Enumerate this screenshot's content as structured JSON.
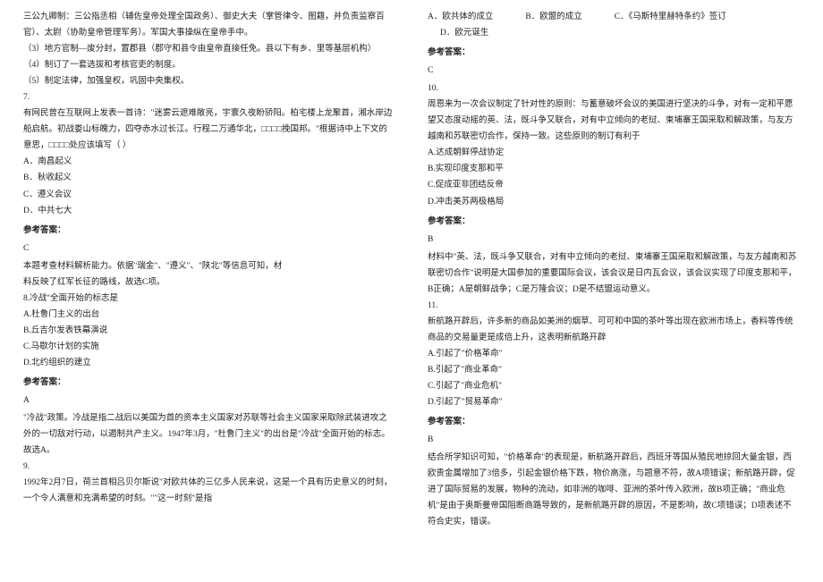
{
  "left": {
    "intro1": "三公九卿制：三公指丞相（辅佐皇帝处理全国政务）、御史大夫（掌管律令、图籍，并负责监察百官）、太尉（协助皇帝管理军务）。军国大事操纵在皇帝手中。",
    "intro2": "（3）地方官制—废分封，置郡县（郡守和县令由皇帝直接任免。县以下有乡、里等基层机构）",
    "intro3": "（4）制订了一套选拔和考核官吏的制度。",
    "intro4": "（5）制定法律，加强皇权，巩固中央集权。",
    "q7num": "7.",
    "q7stem": "有网民曾在互联网上发表一首诗：\"迷雾云遮难敞亮，宇寰久夜盼骄阳。柏宅楼上龙聚首，湘水岸边船启航。初战娄山标魄力，四夺赤水过长江。行程二万通华北，□□□□挽国邦。\"根据诗中上下文的意思，□□□□处应该填写（    ）",
    "q7optA": "A．南昌起义",
    "q7optB": "B．秋收起义",
    "q7optC": "C．遵义会议",
    "q7optD": "D．中共七大",
    "q7ansHead": "参考答案：",
    "q7ansVal": "C",
    "q7exp1": "本题考查材料解析能力。依据\"瑞金\"、\"遵义\"、\"陕北\"等信息可知，材",
    "q7exp2": "料反映了红军长征的路线，故选C项。",
    "q8stem": "8.冷战\"全面开始的标志是",
    "q8optA": "A.杜鲁门主义的出台",
    "q8optB": "B.丘吉尔发表铁幕演说",
    "q8optC": "C.马歇尔计划的实施",
    "q8optD": "D.北约组织的建立",
    "q8ansHead": "参考答案：",
    "q8ansVal": "A",
    "q8exp": "\"冷战\"政策。冷战是指二战后以美国为首的资本主义国家对苏联等社会主义国家采取除武装进攻之外的一切敌对行动，以遏制共产主义。1947年3月，\"杜鲁门主义\"的出台是\"冷战\"全面开始的标志。故选A。",
    "q9num": "9.",
    "q9stem": "1992年2月7日，荷兰首相吕贝尔斯说\"对欧共体的三亿多人民来说，这是一个具有历史意义的时刻，一个令人满意和充满希望的时刻。\"\"这一时刻\"是指"
  },
  "right": {
    "q9optA": "A．欧共体的成立",
    "q9optB": "B．欧盟的成立",
    "q9optC": "C．《马斯特里赫特条约》签订",
    "q9optD": "D．欧元诞生",
    "q9ansHead": "参考答案：",
    "q9ansVal": "C",
    "q10num": "10.",
    "q10stem": "周恩来为一次会议制定了针对性的原则：与蓄意破坏会议的美国进行坚决的斗争，对有一定和平愿望又态度动摇的英、法，既斗争又联合，对有中立倾向的老挝、柬埔寨王国采取和解政策，与友方越南和苏联密切合作，保持一致。这些原则的制订有利于",
    "q10optA": "A.达成朝鲜停战协定",
    "q10optB": "B.实现印度支那和平",
    "q10optC": "C.促成亚非团结反帝",
    "q10optD": "D.冲击美苏两极格局",
    "q10ansHead": "参考答案：",
    "q10ansVal": "B",
    "q10exp": "材料中\"英、法，既斗争又联合，对有中立倾向的老挝、柬埔寨王国采取和解政策，与友方越南和苏联密切合作\"说明是大国参加的重要国际会议，该会议是日内瓦会议，该会议实现了印度支那和平，B正确；A是朝鲜战争；C是万隆会议；D是不结盟运动意义。",
    "q11num": "11.",
    "q11stem": "新航路开辟后，许多新的商品如美洲的烟草、可可和中国的茶叶等出现在欧洲市场上，香料等传统商品的交易量更是成倍上升，这表明新航路开辟",
    "q11optA": "A.引起了\"价格革命\"",
    "q11optB": "B.引起了\"商业革命\"",
    "q11optC": "C.引起了\"商业危机\"",
    "q11optD": "D.引起了\"贸易革命\"",
    "q11ansHead": "参考答案：",
    "q11ansVal": "B",
    "q11exp": "结合所学知识可知，\"价格革命\"的表现是，新航路开辟后，西班牙等国从殖民地掠回大量金银，西欧贵金属增加了3倍多，引起金银价格下跌，物价高涨，与题意不符，故A项错误；新航路开辟，促进了国际贸易的发展，物种的流动，如非洲的咖啡、亚洲的茶叶传入欧洲，故B项正确；\"商业危机\"是由于奥斯曼帝国阻断商路导致的，是新航路开辟的原因，不是影响，故C项错误；D项表述不符合史实，错误。"
  }
}
